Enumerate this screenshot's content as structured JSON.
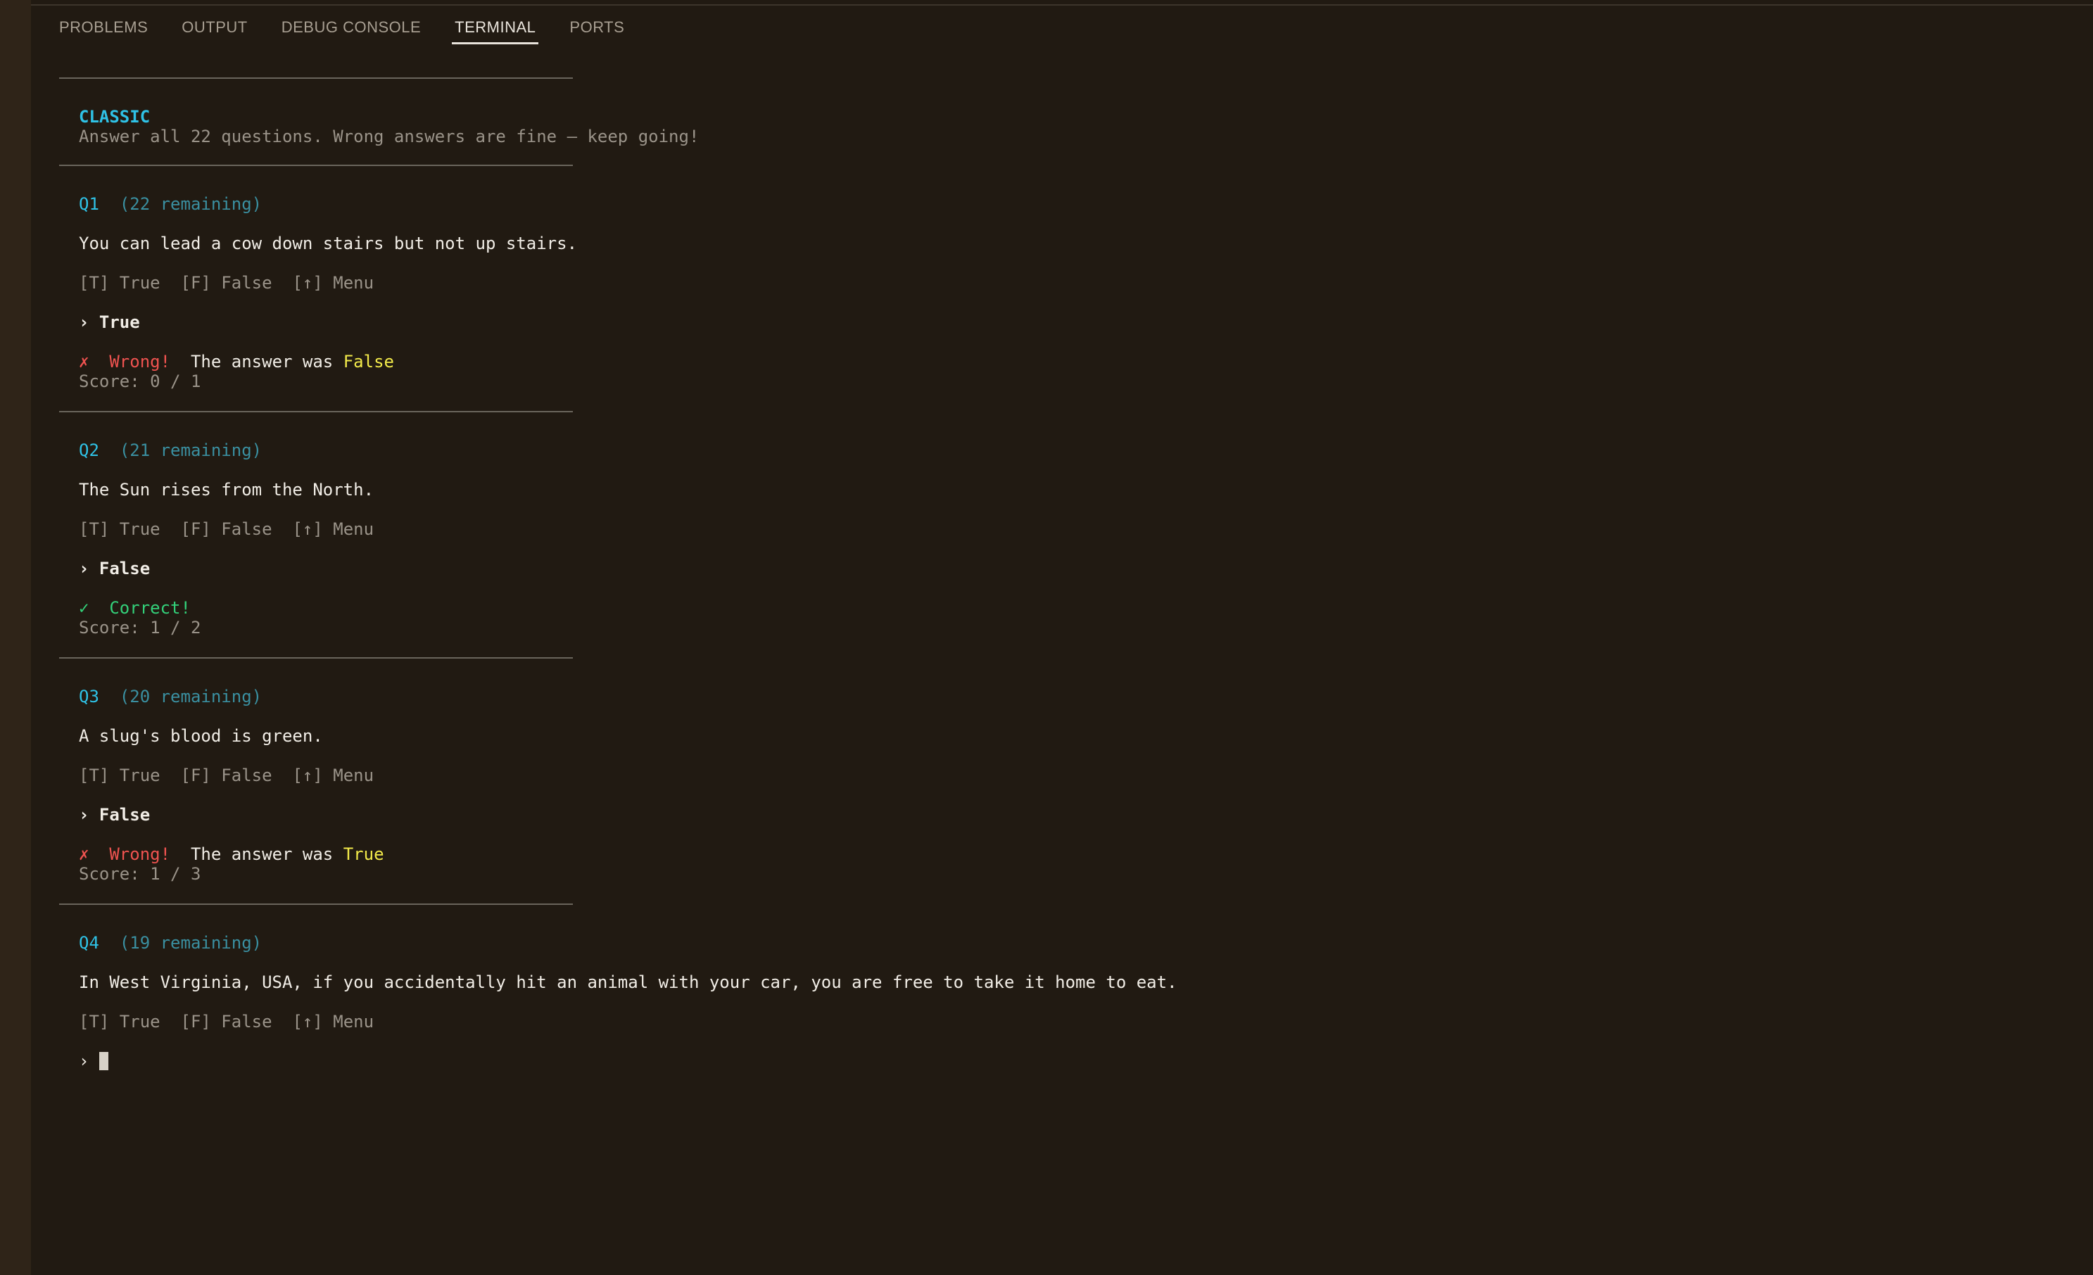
{
  "tabs": [
    {
      "label": "PROBLEMS",
      "active": false
    },
    {
      "label": "OUTPUT",
      "active": false
    },
    {
      "label": "DEBUG CONSOLE",
      "active": false
    },
    {
      "label": "TERMINAL",
      "active": true
    },
    {
      "label": "PORTS",
      "active": false
    }
  ],
  "mode": {
    "title": "CLASSIC",
    "subtitle": "Answer all 22 questions. Wrong answers are fine — keep going!"
  },
  "controls": {
    "true_key": "[T] True",
    "false_key": "[F] False",
    "menu_key": "[↑] Menu"
  },
  "prompt_symbol": "›",
  "questions": [
    {
      "number": "Q1",
      "remaining": "(22 remaining)",
      "text": "You can lead a cow down stairs but not up stairs.",
      "answer": "True",
      "result_symbol": "✗",
      "result_label": "Wrong!",
      "answer_prefix": "The answer was",
      "correct_answer": "False",
      "score": "Score: 0 / 1"
    },
    {
      "number": "Q2",
      "remaining": "(21 remaining)",
      "text": "The Sun rises from the North.",
      "answer": "False",
      "result_symbol": "✓",
      "result_label": "Correct!",
      "score": "Score: 1 / 2"
    },
    {
      "number": "Q3",
      "remaining": "(20 remaining)",
      "text": "A slug's blood is green.",
      "answer": "False",
      "result_symbol": "✗",
      "result_label": "Wrong!",
      "answer_prefix": "The answer was",
      "correct_answer": "True",
      "score": "Score: 1 / 3"
    },
    {
      "number": "Q4",
      "remaining": "(19 remaining)",
      "text": "In West Virginia, USA, if you accidentally hit an animal with your car, you are free to take it home to eat."
    }
  ]
}
